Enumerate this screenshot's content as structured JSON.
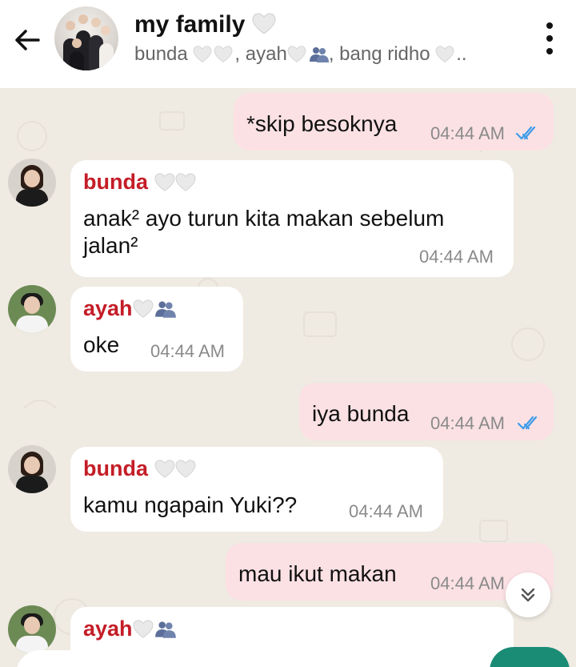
{
  "header": {
    "title": "my family",
    "subtitle": "bunda , ayah, bang ridho .."
  },
  "messages": [
    {
      "dir": "out",
      "text": "*skip besoknya",
      "time": "04:44 AM",
      "status": "read"
    },
    {
      "dir": "in",
      "sender": "bunda",
      "text_line1": "anak² ayo turun kita makan sebelum",
      "text_line2": "jalan²",
      "time": "04:44 AM"
    },
    {
      "dir": "in",
      "sender": "ayah",
      "text": "oke",
      "time": "04:44 AM"
    },
    {
      "dir": "out",
      "text": "iya bunda",
      "time": "04:44 AM",
      "status": "read"
    },
    {
      "dir": "in",
      "sender": "bunda",
      "text": "kamu ngapain Yuki??",
      "time": "04:44 AM"
    },
    {
      "dir": "out",
      "text": "mau ikut makan",
      "time": "04:44 AM",
      "status": "read"
    },
    {
      "dir": "in",
      "sender": "ayah",
      "text": "",
      "time": ""
    }
  ],
  "colors": {
    "sender_name": "#c41d27",
    "outgoing_bubble": "#fbe1e4",
    "incoming_bubble": "#ffffff",
    "read_ticks": "#3d9be9",
    "send_fab": "#1a8c76"
  },
  "icons": {
    "back": "arrow-left-icon",
    "menu": "kebab-menu-icon",
    "heart": "white-heart-emoji",
    "busts": "busts-in-silhouette-emoji",
    "scroll": "double-chevron-down-icon"
  }
}
